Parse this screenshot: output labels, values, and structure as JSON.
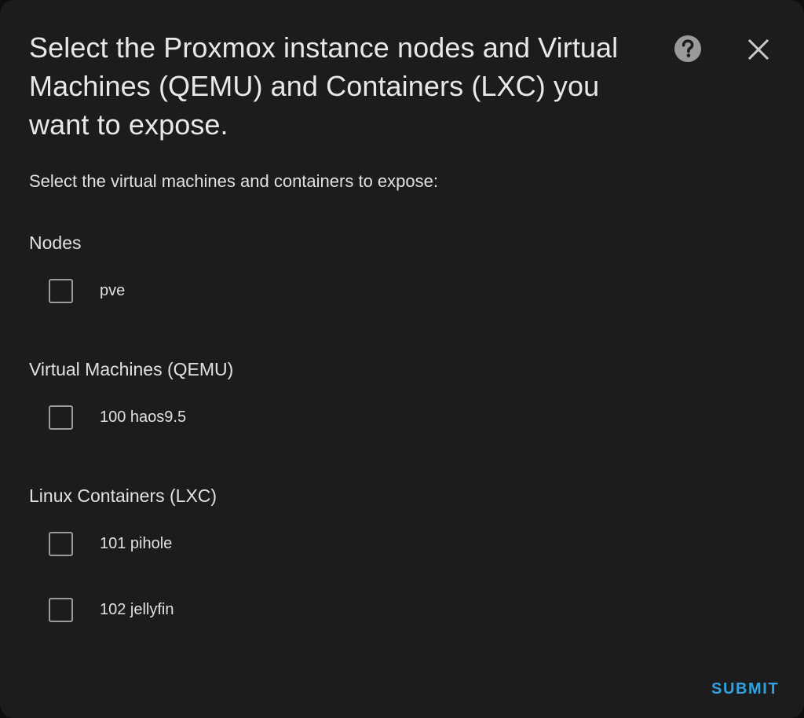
{
  "dialog": {
    "title": "Select the Proxmox instance nodes and Virtual Machines (QEMU) and Containers (LXC) you want to expose.",
    "description": "Select the virtual machines and containers to expose:",
    "help_icon": "help-circle-icon",
    "close_icon": "close-icon"
  },
  "sections": [
    {
      "title": "Nodes",
      "items": [
        {
          "label": "pve",
          "checked": false
        }
      ]
    },
    {
      "title": "Virtual Machines (QEMU)",
      "items": [
        {
          "label": "100 haos9.5",
          "checked": false
        }
      ]
    },
    {
      "title": "Linux Containers (LXC)",
      "items": [
        {
          "label": "101 pihole",
          "checked": false
        },
        {
          "label": "102 jellyfin",
          "checked": false
        }
      ]
    }
  ],
  "actions": {
    "submit_label": "SUBMIT"
  },
  "colors": {
    "background": "#1c1c1c",
    "text": "#e1e1e1",
    "accent": "#2ea3df",
    "checkbox_border": "#9b9b9b"
  }
}
